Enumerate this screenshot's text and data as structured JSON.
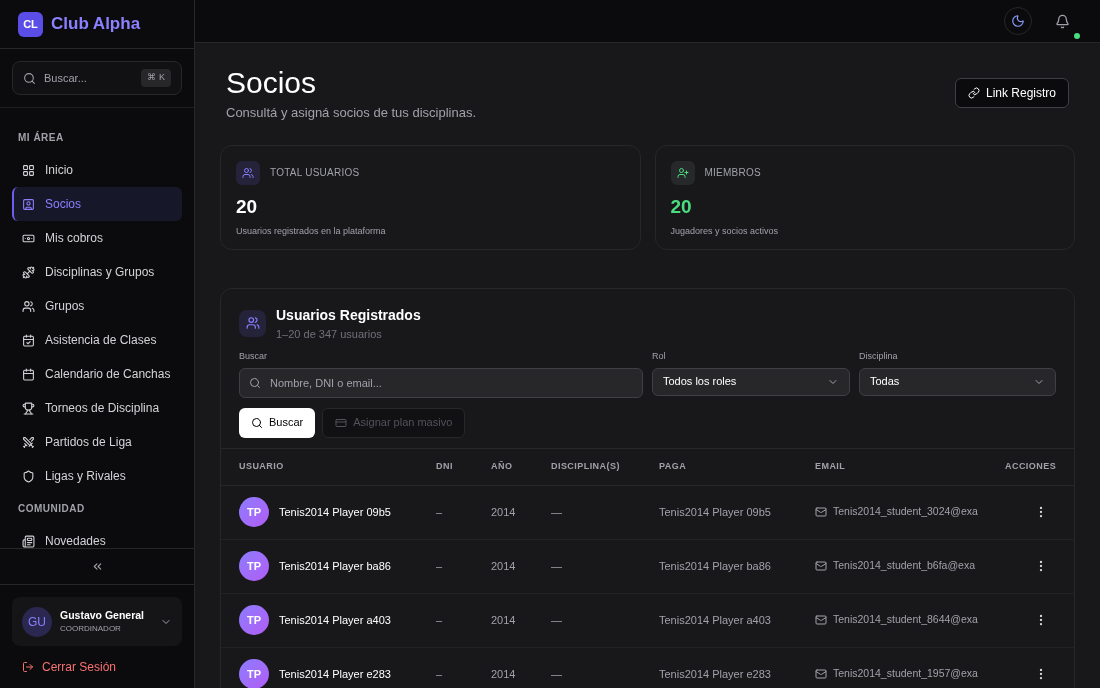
{
  "brand": {
    "initials": "CL",
    "name": "Club Alpha"
  },
  "sidebar": {
    "search": {
      "placeholder": "Buscar...",
      "shortcut": "⌘ K"
    },
    "sections": [
      {
        "title": "MI ÁREA",
        "items": [
          {
            "label": "Inicio",
            "selected": false
          },
          {
            "label": "Socios",
            "selected": true
          },
          {
            "label": "Mis cobros",
            "selected": false
          },
          {
            "label": "Disciplinas y Grupos",
            "selected": false
          },
          {
            "label": "Grupos",
            "selected": false
          },
          {
            "label": "Asistencia de Clases",
            "selected": false
          },
          {
            "label": "Calendario de Canchas",
            "selected": false
          },
          {
            "label": "Torneos de Disciplina",
            "selected": false
          },
          {
            "label": "Partidos de Liga",
            "selected": false
          },
          {
            "label": "Ligas y Rivales",
            "selected": false
          }
        ]
      },
      {
        "title": "COMUNIDAD",
        "items": [
          {
            "label": "Novedades",
            "selected": false
          }
        ]
      }
    ],
    "user": {
      "initials": "GU",
      "name": "Gustavo General",
      "role": "COORDINADOR"
    },
    "logout": "Cerrar Sesión"
  },
  "page": {
    "title": "Socios",
    "subtitle": "Consultá y asigná socios de tus disciplinas.",
    "action": "Link Registro"
  },
  "stats": [
    {
      "kind": "total",
      "label": "TOTAL USUARIOS",
      "value": "20",
      "caption": "Usuarios registrados en la plataforma"
    },
    {
      "kind": "members",
      "label": "MIEMBROS",
      "value": "20",
      "caption": "Jugadores y socios activos"
    }
  ],
  "users_panel": {
    "title": "Usuarios Registrados",
    "subtitle": "1–20 de 347 usuarios",
    "search": {
      "label": "Buscar",
      "placeholder": "Nombre, DNI o email..."
    },
    "role": {
      "label": "Rol",
      "value": "Todos los roles"
    },
    "discipline": {
      "label": "Disciplina",
      "value": "Todas"
    },
    "search_button": "Buscar",
    "bulk_button": {
      "label": "Asignar plan masivo",
      "disabled": true
    },
    "table": {
      "columns": [
        "USUARIO",
        "DNI",
        "AÑO",
        "DISCIPLINA(S)",
        "PAGA",
        "EMAIL",
        "ACCIONES"
      ],
      "rows": [
        {
          "initials": "TP",
          "name": "Tenis2014 Player 09b5",
          "dni": "–",
          "year": "2014",
          "disciplines": "—",
          "payer": "Tenis2014 Player 09b5",
          "email": "Tenis2014_student_3024@exa"
        },
        {
          "initials": "TP",
          "name": "Tenis2014 Player ba86",
          "dni": "–",
          "year": "2014",
          "disciplines": "—",
          "payer": "Tenis2014 Player ba86",
          "email": "Tenis2014_student_b6fa@exa"
        },
        {
          "initials": "TP",
          "name": "Tenis2014 Player a403",
          "dni": "–",
          "year": "2014",
          "disciplines": "—",
          "payer": "Tenis2014 Player a403",
          "email": "Tenis2014_student_8644@exa"
        },
        {
          "initials": "TP",
          "name": "Tenis2014 Player e283",
          "dni": "–",
          "year": "2014",
          "disciplines": "—",
          "payer": "Tenis2014 Player e283",
          "email": "Tenis2014_student_1957@exa"
        }
      ]
    }
  }
}
